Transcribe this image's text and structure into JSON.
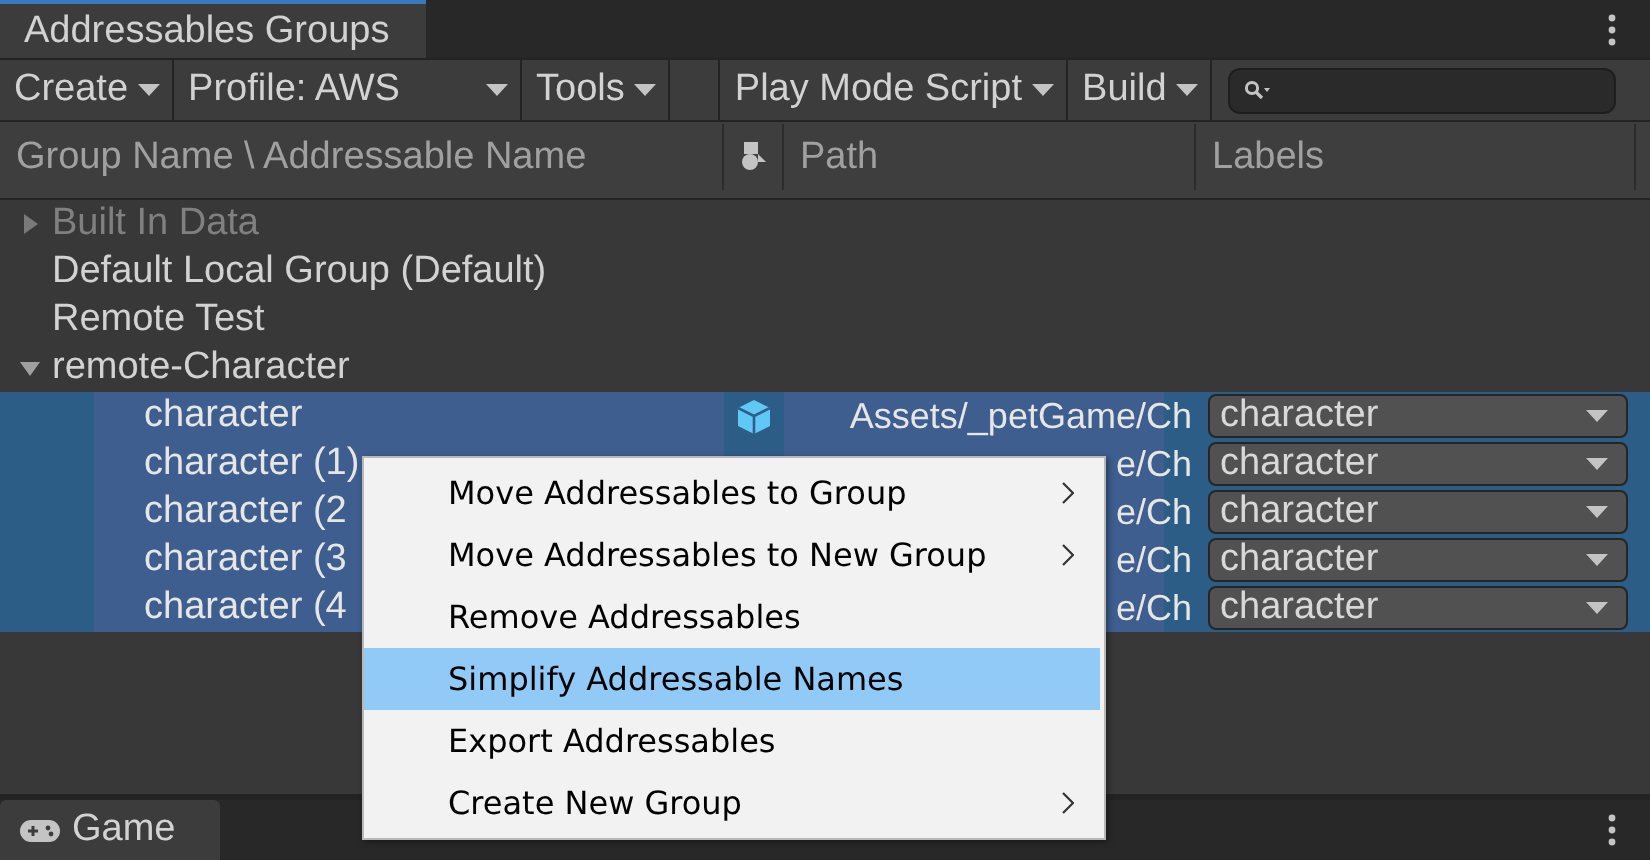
{
  "window": {
    "tab": "Addressables Groups"
  },
  "toolbar": [
    {
      "label": "Create",
      "kind": "dropdown"
    },
    {
      "label": "Profile: AWS",
      "kind": "dropdown"
    },
    {
      "label": "Tools",
      "kind": "dropdown"
    },
    {
      "kind": "spacer"
    },
    {
      "label": "Play Mode Script",
      "kind": "dropdown"
    },
    {
      "label": "Build",
      "kind": "dropdown"
    },
    {
      "kind": "search"
    }
  ],
  "columns": [
    {
      "label": "Group Name \\ Addressable Name",
      "kind": "text"
    },
    {
      "kind": "icon"
    },
    {
      "label": "Path",
      "kind": "text"
    },
    {
      "label": "Labels",
      "kind": "text"
    }
  ],
  "groups": [
    {
      "name": "Built In Data",
      "disabled": true,
      "expanded": false
    },
    {
      "name": "Default Local Group (Default)",
      "disabled": false
    },
    {
      "name": "Remote Test",
      "disabled": false
    },
    {
      "name": "remote-Character",
      "disabled": false,
      "expanded": true,
      "children": [
        {
          "name": "character",
          "path": "Assets/_petGame/Ch",
          "label": "character",
          "selected": true,
          "icon": true
        },
        {
          "name": "character (1)",
          "path": "e/Ch",
          "label": "character",
          "selected": true,
          "icon": false
        },
        {
          "name": "character (2",
          "path": "e/Ch",
          "label": "character",
          "selected": true,
          "icon": false
        },
        {
          "name": "character (3",
          "path": "e/Ch",
          "label": "character",
          "selected": true,
          "icon": false
        },
        {
          "name": "character (4",
          "path": "e/Ch",
          "label": "character",
          "selected": true,
          "icon": false
        }
      ]
    }
  ],
  "context_menu": [
    {
      "label": "Move Addressables to Group",
      "submenu": true,
      "selected": false
    },
    {
      "label": "Move Addressables to New Group",
      "submenu": true,
      "selected": false
    },
    {
      "label": "Remove Addressables",
      "submenu": false,
      "selected": false
    },
    {
      "label": "Simplify Addressable Names",
      "submenu": false,
      "selected": true
    },
    {
      "label": "Export Addressables",
      "submenu": false,
      "selected": false
    },
    {
      "label": "Create New Group",
      "submenu": true,
      "selected": false
    }
  ],
  "bottom_tab": {
    "label": "Game"
  }
}
